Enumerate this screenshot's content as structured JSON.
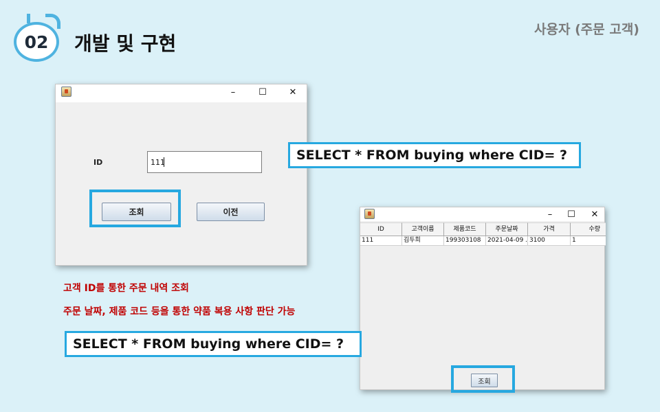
{
  "slide": {
    "number": "02",
    "title": "개발 및 구현",
    "section": "사용자 (주문 고객)"
  },
  "window1": {
    "controls": {
      "minimize": "–",
      "maximize": "☐",
      "close": "✕"
    },
    "id_label": "ID",
    "id_value": "111",
    "search_button": "조회",
    "prev_button": "이전"
  },
  "window2": {
    "controls": {
      "minimize": "–",
      "maximize": "☐",
      "close": "✕"
    },
    "columns": [
      "ID",
      "고객이름",
      "제품코드",
      "주문날짜",
      "가격",
      "수량"
    ],
    "rows": [
      [
        "111",
        "김두희",
        "199303108",
        "2021-04-09 ...",
        "3100",
        "1"
      ]
    ],
    "search_button": "조회"
  },
  "sql_query_top": "SELECT * FROM buying where CID= ?",
  "sql_query_bottom": "SELECT * FROM buying where CID= ?",
  "notes": [
    "고객 ID를 통한 주문 내역 조회",
    "주문 날짜, 제품 코드 등을 통한 약품 복용 사항 판단 가능"
  ],
  "colors": {
    "highlight": "#26a8e0",
    "note_text": "#c00000",
    "background": "#dbf1f8"
  }
}
